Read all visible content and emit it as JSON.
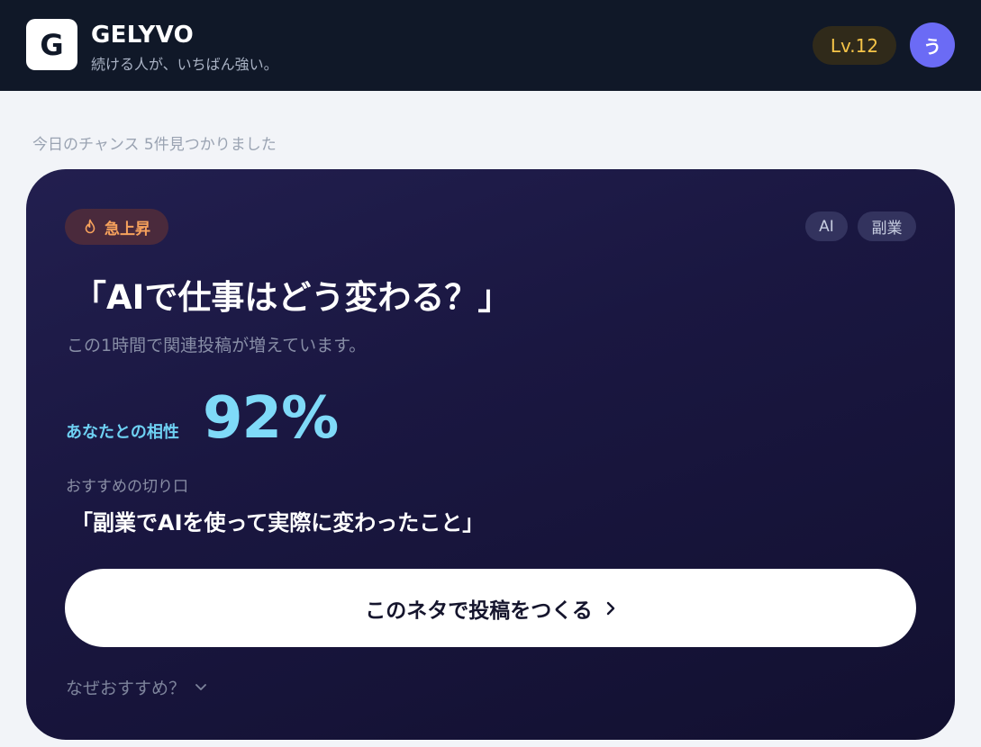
{
  "header": {
    "logo_letter": "G",
    "brand_name": "GELYVO",
    "tagline": "続ける人が、いちばん強い。",
    "level": "Lv.12",
    "avatar_initial": "う"
  },
  "feed": {
    "found_text": "今日のチャンス 5件見つかりました"
  },
  "card": {
    "badge_label": "急上昇",
    "tags": [
      "AI",
      "副業"
    ],
    "title": "「AIで仕事はどう変わる？」",
    "description": "この1時間で関連投稿が増えています。",
    "compat_label": "あなたとの相性",
    "compat_value": "92%",
    "angle_label": "おすすめの切り口",
    "angle_text": "「副業でAIを使って実際に変わったこと」",
    "cta_label": "このネタで投稿をつくる",
    "why_label": "なぜおすすめ？"
  },
  "colors": {
    "header_bg": "#101828",
    "page_bg": "#f2f4f8",
    "card_bg": "#1a1741",
    "accent_cyan": "#7fdaf8",
    "level_gold": "#f6c548",
    "trend_orange": "#f6a15c",
    "avatar_purple": "#6b6bf5"
  },
  "icons": {
    "trend": "flame-icon",
    "cta": "chevron-right-icon",
    "why": "chevron-down-icon"
  }
}
